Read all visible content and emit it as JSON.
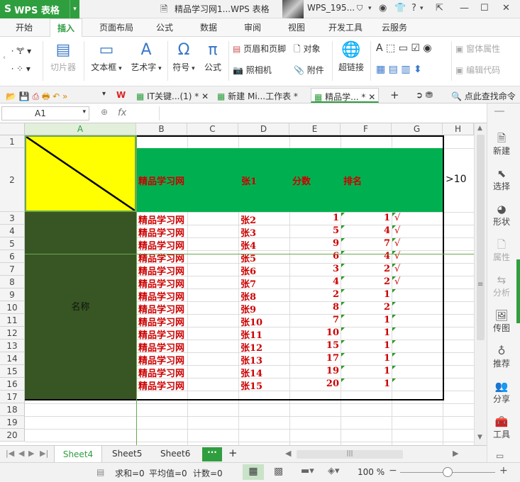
{
  "titlebar": {
    "app": "WPS 表格",
    "logo": "S",
    "doc_title": "精品学习网1...WPS 表格",
    "user": "WPS_195...",
    "help": "?"
  },
  "menu": [
    "开始",
    "插入",
    "页面布局",
    "公式",
    "数据",
    "审阅",
    "视图",
    "开发工具",
    "云服务"
  ],
  "menu_active": "插入",
  "ribbon": {
    "cut_tool": "切片器",
    "textbox": "文本框",
    "wordart": "艺术字",
    "symbol": "符号",
    "formula": "公式",
    "header_footer": "页眉和页脚",
    "object": "对象",
    "camera": "照相机",
    "attachment": "附件",
    "hyperlink": "超链接",
    "form_props": "窗体属性",
    "edit_code": "编辑代码"
  },
  "doctabs": [
    {
      "label": "IT关键...(1) *"
    },
    {
      "label": "新建 Mi...工作表 *"
    },
    {
      "label": "精品学... *"
    }
  ],
  "search_label": "点此查找命令",
  "namebox": "A1",
  "fx": "fx",
  "columns": [
    "A",
    "B",
    "C",
    "D",
    "E",
    "F",
    "G",
    "H"
  ],
  "rows": [
    "1",
    "2",
    "3",
    "4",
    "5",
    "6",
    "7",
    "8",
    "9",
    "10",
    "11",
    "12",
    "13",
    "14",
    "15",
    "16",
    "17",
    "18",
    "19",
    "20"
  ],
  "header_row": {
    "b": "精品学习网",
    "d": "张1",
    "e": "分数",
    "f": "排名",
    "h": ">10"
  },
  "merged_label": "名称",
  "data_rows": [
    {
      "b": "精品学习网",
      "d": "张2",
      "e": "1",
      "f": "1",
      "g": "√"
    },
    {
      "b": "精品学习网",
      "d": "张3",
      "e": "5",
      "f": "4",
      "g": "√"
    },
    {
      "b": "精品学习网",
      "d": "张4",
      "e": "9",
      "f": "7",
      "g": "√"
    },
    {
      "b": "精品学习网",
      "d": "张5",
      "e": "6",
      "f": "4",
      "g": "√"
    },
    {
      "b": "精品学习网",
      "d": "张6",
      "e": "3",
      "f": "2",
      "g": "√"
    },
    {
      "b": "精品学习网",
      "d": "张7",
      "e": "4",
      "f": "2",
      "g": "√"
    },
    {
      "b": "精品学习网",
      "d": "张8",
      "e": "2",
      "f": "1",
      "g": ""
    },
    {
      "b": "精品学习网",
      "d": "张9",
      "e": "8",
      "f": "2",
      "g": ""
    },
    {
      "b": "精品学习网",
      "d": "张10",
      "e": "7",
      "f": "1",
      "g": ""
    },
    {
      "b": "精品学习网",
      "d": "张11",
      "e": "10",
      "f": "1",
      "g": ""
    },
    {
      "b": "精品学习网",
      "d": "张12",
      "e": "15",
      "f": "1",
      "g": ""
    },
    {
      "b": "精品学习网",
      "d": "张13",
      "e": "17",
      "f": "1",
      "g": ""
    },
    {
      "b": "精品学习网",
      "d": "张14",
      "e": "19",
      "f": "1",
      "g": ""
    },
    {
      "b": "精品学习网",
      "d": "张15",
      "e": "20",
      "f": "1",
      "g": ""
    }
  ],
  "right_panel": [
    "新建",
    "选择",
    "形状",
    "属性",
    "分析",
    "传图",
    "推荐",
    "分享",
    "工具"
  ],
  "sheets": [
    "Sheet4",
    "Sheet5",
    "Sheet6"
  ],
  "sheet_active": "Sheet4",
  "more": "···",
  "status": {
    "sum": "求和=0",
    "avg": "平均值=0",
    "count": "计数=0",
    "zoom": "100 %"
  },
  "colors": {
    "green": "#2f9e3f",
    "header_fill": "#00b050",
    "yellow": "#ffff00",
    "dark_fill": "#375623",
    "text_red": "#c00000"
  }
}
